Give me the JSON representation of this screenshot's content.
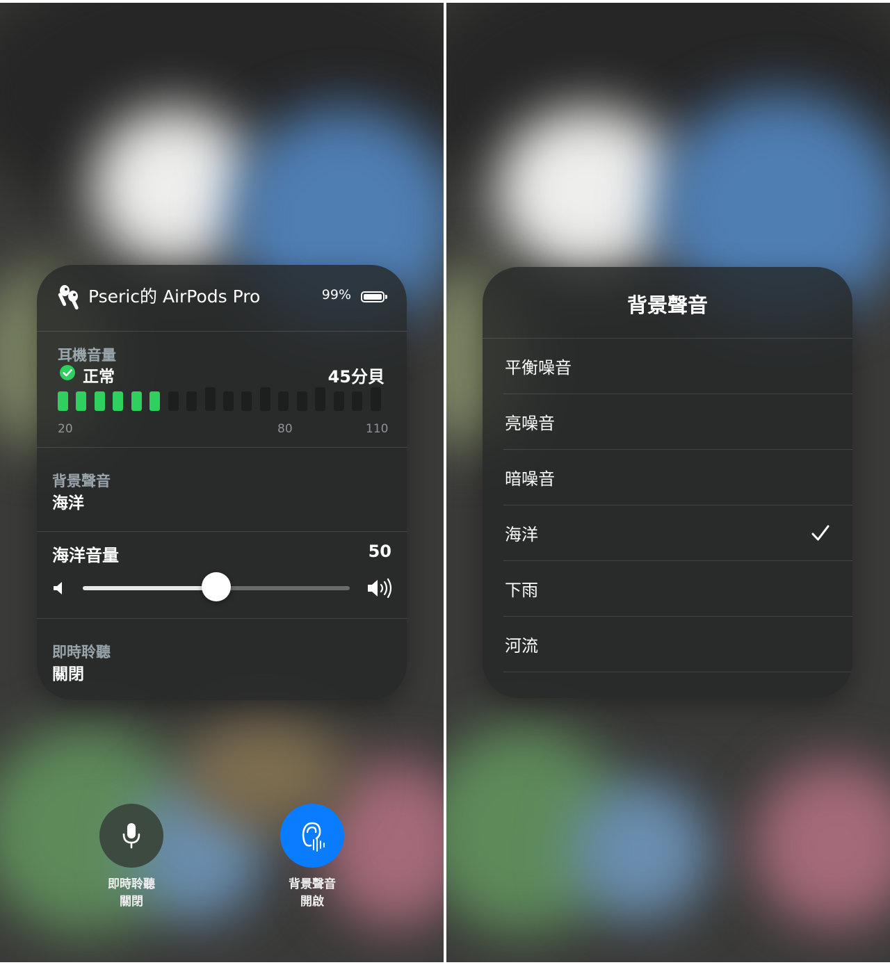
{
  "left_panel": {
    "header": {
      "title": "Pseric的 AirPods Pro",
      "battery_percent": "99%",
      "battery_level": 0.99
    },
    "headphone_level": {
      "label": "耳機音量",
      "status": "正常",
      "value": "45分貝",
      "lit_segments": 6,
      "total_segments": 18,
      "scale_labels": [
        "20",
        "80",
        "110"
      ]
    },
    "background_sounds": {
      "label": "背景聲音",
      "value": "海洋"
    },
    "ocean_volume": {
      "label": "海洋音量",
      "value": "50",
      "level": 0.5
    },
    "live_listen": {
      "label": "即時聆聽",
      "value": "關閉"
    },
    "buttons": {
      "live_listen": {
        "line1": "即時聆聽",
        "line2": "關閉"
      },
      "background_sounds": {
        "line1": "背景聲音",
        "line2": "開啟"
      }
    },
    "colors": {
      "meter_green": "#2fd05e",
      "active_blue": "#0a7cff",
      "inactive_btn": "#3d4a3f"
    }
  },
  "right_panel": {
    "title": "背景聲音",
    "options": [
      {
        "label": "平衡噪音",
        "selected": false
      },
      {
        "label": "亮噪音",
        "selected": false
      },
      {
        "label": "暗噪音",
        "selected": false
      },
      {
        "label": "海洋",
        "selected": true
      },
      {
        "label": "下雨",
        "selected": false
      },
      {
        "label": "河流",
        "selected": false
      }
    ]
  }
}
